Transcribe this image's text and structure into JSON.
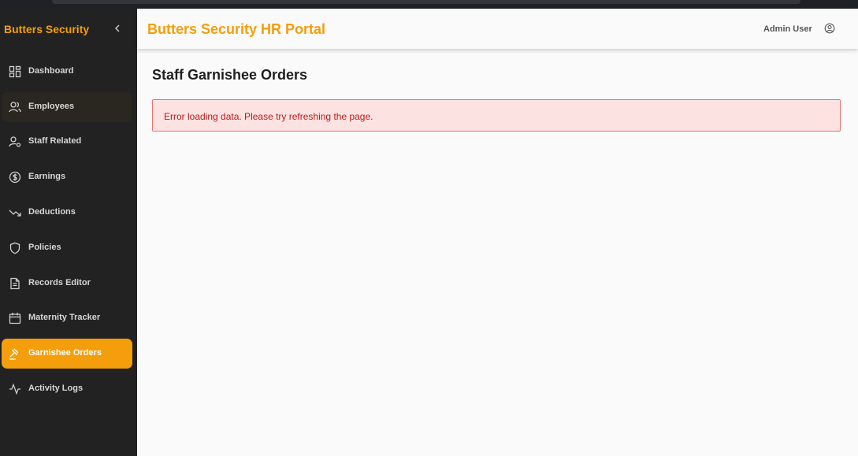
{
  "app": {
    "brand": "Butters Security",
    "portal_title": "Butters Security HR Portal"
  },
  "header": {
    "user_name": "Admin User",
    "user_icon": "user-circle-icon"
  },
  "sidebar": {
    "items": [
      {
        "label": "Dashboard",
        "icon": "dashboard-grid-icon"
      },
      {
        "label": "Employees",
        "icon": "users-icon"
      },
      {
        "label": "Staff Related",
        "icon": "user-settings-icon"
      },
      {
        "label": "Earnings",
        "icon": "dollar-circle-icon"
      },
      {
        "label": "Deductions",
        "icon": "trending-down-icon"
      },
      {
        "label": "Policies",
        "icon": "shield-icon"
      },
      {
        "label": "Records Editor",
        "icon": "document-icon"
      },
      {
        "label": "Maternity Tracker",
        "icon": "calendar-icon"
      },
      {
        "label": "Garnishee Orders",
        "icon": "gavel-icon"
      },
      {
        "label": "Activity Logs",
        "icon": "activity-icon"
      }
    ],
    "active": "Garnishee Orders",
    "hovered": "Employees"
  },
  "main": {
    "page_title": "Staff Garnishee Orders",
    "error_message": "Error loading data. Please try refreshing the page."
  },
  "colors": {
    "accent": "#f59e0b",
    "sidebar_bg": "#222222",
    "error_bg": "#fde2e2",
    "error_border": "#e57373",
    "error_text": "#b71c1c"
  }
}
